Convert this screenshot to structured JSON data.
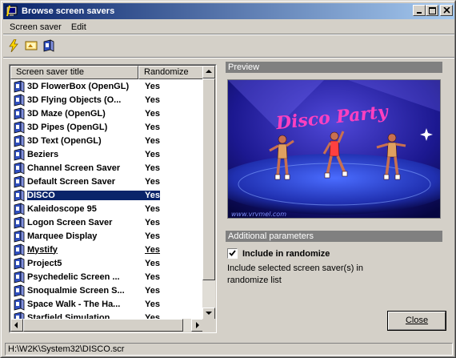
{
  "window": {
    "title": "Browse screen savers"
  },
  "menu": {
    "items": [
      "Screen saver",
      "Edit"
    ]
  },
  "toolbar": {
    "icons": [
      "run-icon",
      "preview-icon",
      "properties-icon"
    ]
  },
  "list": {
    "columns": [
      "Screen saver title",
      "Randomize"
    ],
    "rows": [
      {
        "name": "3D FlowerBox (OpenGL)",
        "randomize": "Yes"
      },
      {
        "name": "3D Flying Objects (O...",
        "randomize": "Yes"
      },
      {
        "name": "3D Maze (OpenGL)",
        "randomize": "Yes"
      },
      {
        "name": "3D Pipes (OpenGL)",
        "randomize": "Yes"
      },
      {
        "name": "3D Text (OpenGL)",
        "randomize": "Yes"
      },
      {
        "name": "Beziers",
        "randomize": "Yes"
      },
      {
        "name": "Channel Screen Saver",
        "randomize": "Yes"
      },
      {
        "name": "Default Screen Saver",
        "randomize": "Yes"
      },
      {
        "name": "DISCO",
        "randomize": "Yes",
        "selected": true
      },
      {
        "name": "Kaleidoscope 95",
        "randomize": "Yes"
      },
      {
        "name": "Logon Screen Saver",
        "randomize": "Yes"
      },
      {
        "name": "Marquee Display",
        "randomize": "Yes"
      },
      {
        "name": "Mystify",
        "randomize": "Yes",
        "underline": true
      },
      {
        "name": "Project5",
        "randomize": "Yes"
      },
      {
        "name": "Psychedelic Screen ...",
        "randomize": "Yes"
      },
      {
        "name": "Snoqualmie Screen S...",
        "randomize": "Yes"
      },
      {
        "name": "Space Walk - The Ha...",
        "randomize": "Yes"
      },
      {
        "name": "Starfield Simulation",
        "randomize": "Yes"
      }
    ]
  },
  "preview": {
    "heading": "Preview",
    "banner": "Disco Party",
    "url": "www.vrvmel.com"
  },
  "params": {
    "heading": "Additional parameters",
    "checkbox_label": "Include in randomize",
    "checkbox_checked": true,
    "description": "Include selected screen saver(s) in randomize list"
  },
  "buttons": {
    "close": "Close"
  },
  "status": {
    "path": "H:\\W2K\\System32\\DISCO.scr"
  }
}
